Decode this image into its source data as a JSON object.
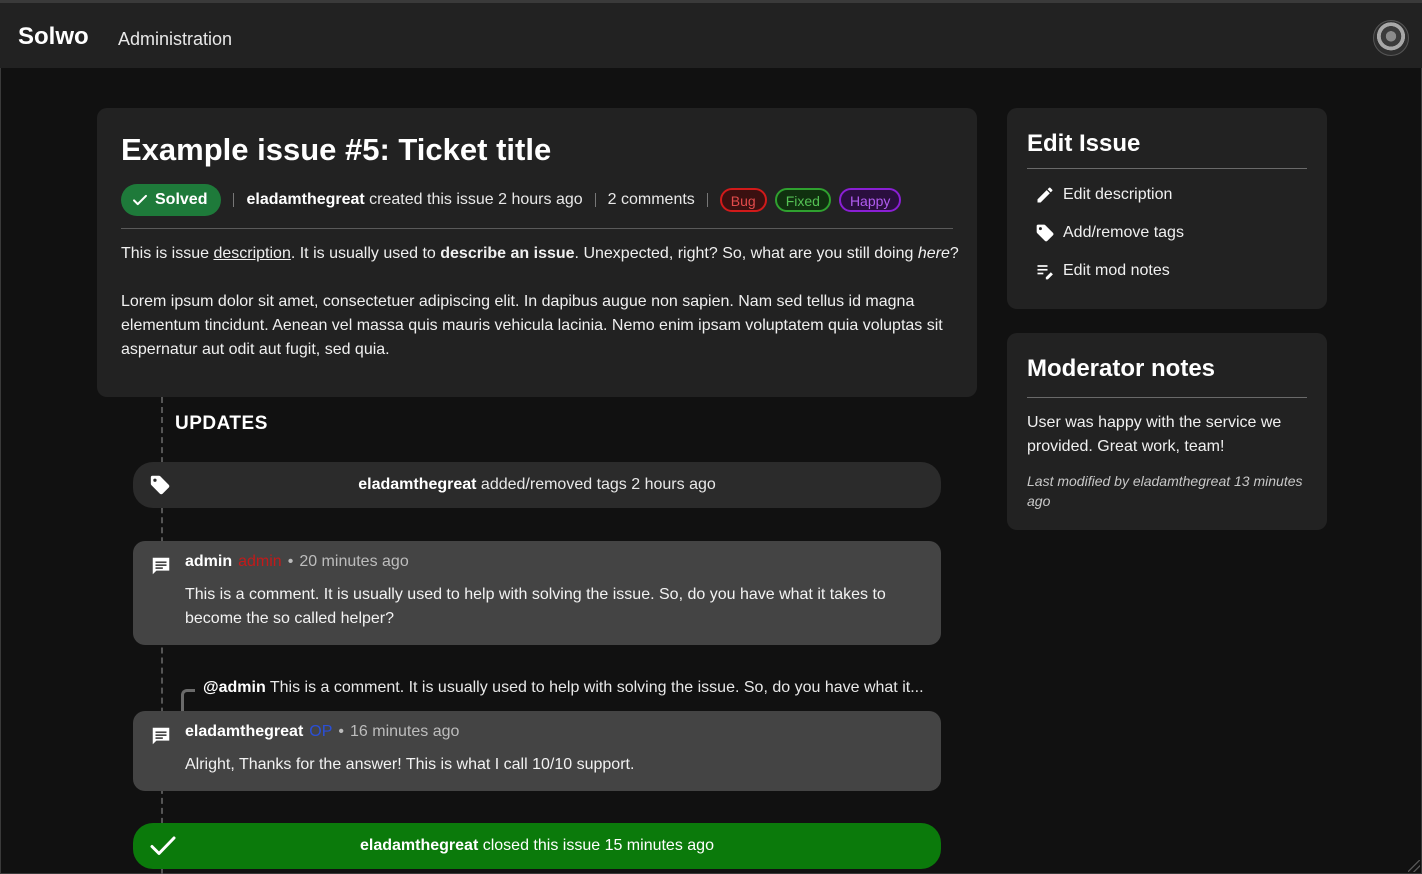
{
  "header": {
    "brand": "Solwo",
    "nav_admin": "Administration"
  },
  "issue": {
    "title": "Example issue #5: Ticket title",
    "status": "Solved",
    "author": "eladamthegreat",
    "created_text": " created this issue 2 hours ago",
    "comments_count": "2 comments",
    "tags": [
      "Bug",
      "Fixed",
      "Happy"
    ],
    "description": {
      "p1_a": "This is issue ",
      "p1_link": "description",
      "p1_b": ". It is usually used to ",
      "p1_bold": "describe an issue",
      "p1_c": ". Unexpected, right? So, what are you still doing ",
      "p1_italic": "here",
      "p1_d": "?",
      "p2": "Lorem ipsum dolor sit amet, consectetuer adipiscing elit. In dapibus augue non sapien. Nam sed tellus id magna elementum tincidunt. Aenean vel massa quis mauris vehicula lacinia. Nemo enim ipsam voluptatem quia voluptas sit aspernatur aut odit aut fugit, sed quia."
    }
  },
  "updates": {
    "title": "UPDATES",
    "tag_event": {
      "user": "eladamthegreat",
      "text": " added/removed tags 2 hours ago"
    },
    "comment1": {
      "author": "admin",
      "role": "admin",
      "time": "20 minutes ago",
      "body": "This is a comment. It is usually used to help with solving the issue. So, do you have what it takes to become the so called helper?"
    },
    "reply_quote": {
      "mention": "@admin",
      "text": " This is a comment. It is usually used to help with solving the issue. So, do you have what it..."
    },
    "comment2": {
      "author": "eladamthegreat",
      "role": "OP",
      "time": "16 minutes ago",
      "body": "Alright, Thanks for the answer! This is what I call 10/10 support."
    },
    "closed_event": {
      "user": "eladamthegreat",
      "text": " closed this issue 15 minutes ago"
    }
  },
  "sidebar": {
    "edit_title": "Edit Issue",
    "edit_items": [
      "Edit description",
      "Add/remove tags",
      "Edit mod notes"
    ],
    "notes_title": "Moderator notes",
    "notes_text": "User was happy with the service we provided. Great work, team!",
    "notes_modified": "Last modified by eladamthegreat 13 minutes ago"
  },
  "colors": {
    "solved_green": "#1e7a3a",
    "closed_green": "#0b7a0b",
    "admin_red": "#c21a1a",
    "op_blue": "#2a4fd8",
    "tag_bug": "#d11a1a",
    "tag_fixed": "#2fa12f",
    "tag_happy": "#8a1fd4"
  },
  "icons": [
    "check-icon",
    "tag-icon",
    "comment-icon",
    "pencil-icon",
    "edit-notes-icon"
  ]
}
